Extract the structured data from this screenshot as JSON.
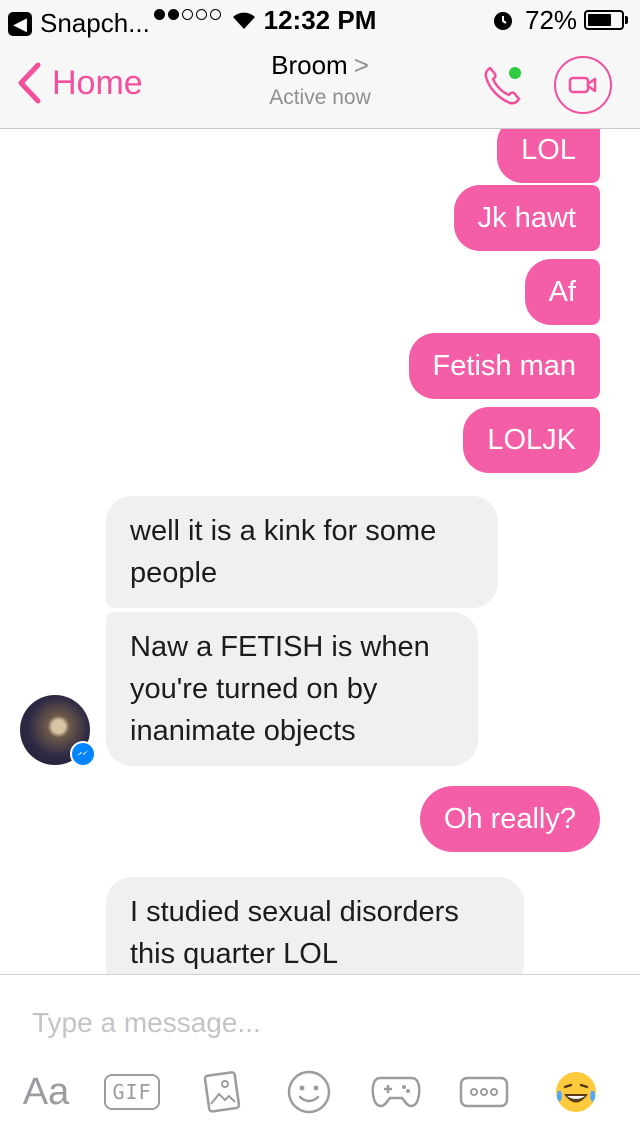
{
  "status_bar": {
    "back_app": "Snapch...",
    "time": "12:32 PM",
    "battery": "72%",
    "battery_level": 0.72
  },
  "nav": {
    "back_label": "Home",
    "title": "Broom",
    "title_chevron": ">",
    "subtitle": "Active now",
    "call_icon": "phone-icon",
    "video_icon": "video-camera-icon",
    "online_color": "#2ecc40"
  },
  "theme": {
    "accent": "#f24f9c",
    "sent_bubble": "#f45ea7",
    "received_bubble": "#f1f0f0"
  },
  "messages": [
    {
      "from": "me",
      "text": "LOL"
    },
    {
      "from": "me",
      "text": "Jk hawt"
    },
    {
      "from": "me",
      "text": "Af"
    },
    {
      "from": "me",
      "text": "Fetish man"
    },
    {
      "from": "me",
      "text": "LOLJK"
    },
    {
      "from": "them",
      "text": "well it is a kink for some people"
    },
    {
      "from": "them",
      "text": "Naw a FETISH is when you're turned on by inanimate objects"
    },
    {
      "from": "me",
      "text": "Oh really?"
    },
    {
      "from": "them",
      "text": "I studied sexual disorders this quarter LOL"
    }
  ],
  "composer": {
    "placeholder": "Type a message...",
    "tools": [
      "Aa",
      "GIF",
      "photo-icon",
      "emoji-icon",
      "game-controller-icon",
      "more-icon",
      "laughing-emoji-icon"
    ]
  }
}
